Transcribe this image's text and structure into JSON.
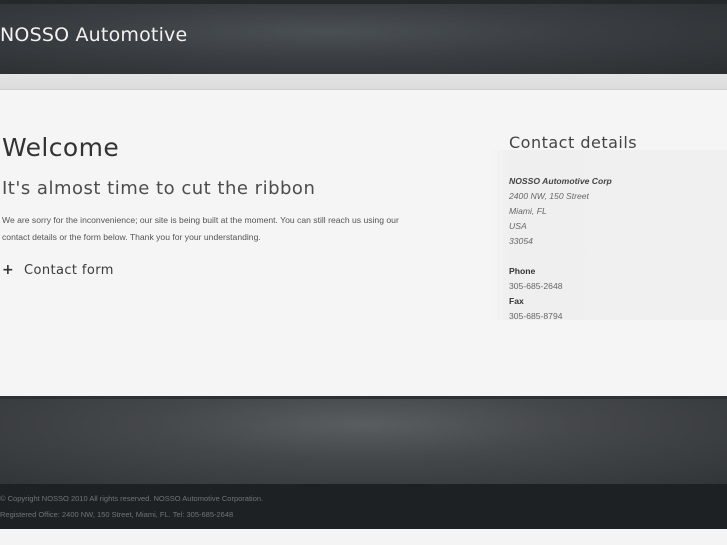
{
  "header": {
    "site_title": "NOSSO Automotive"
  },
  "main": {
    "welcome_title": "Welcome",
    "subtitle": "It's almost time to cut the ribbon",
    "intro_line1": "We are sorry for the inconvenience; our site is being built at the moment. You can still reach us using our",
    "intro_line2": "contact details or the form below. Thank you for your understanding.",
    "contact_form_toggle": "Contact form",
    "toggle_icon": "plus-icon"
  },
  "contact": {
    "heading": "Contact details",
    "company": "NOSSO Automotive Corp",
    "street": "2400 NW, 150 Street",
    "city": "Miami, FL",
    "country": "USA",
    "zip": "33054",
    "phone_label": "Phone",
    "phone": "305-685-2648",
    "fax_label": "Fax",
    "fax": "305-685-8794"
  },
  "footer": {
    "copyright": "© Copyright NOSSO 2010 All rights reserved. NOSSO Automotive Corporation.",
    "registered": "Registered Office: 2400 NW, 150 Street, Miami, FL. Tel: 305-685-2648"
  },
  "colors": {
    "header_bg": "#3a3e42",
    "content_bg": "#f5f5f5",
    "footer_bg": "#1e2124"
  }
}
